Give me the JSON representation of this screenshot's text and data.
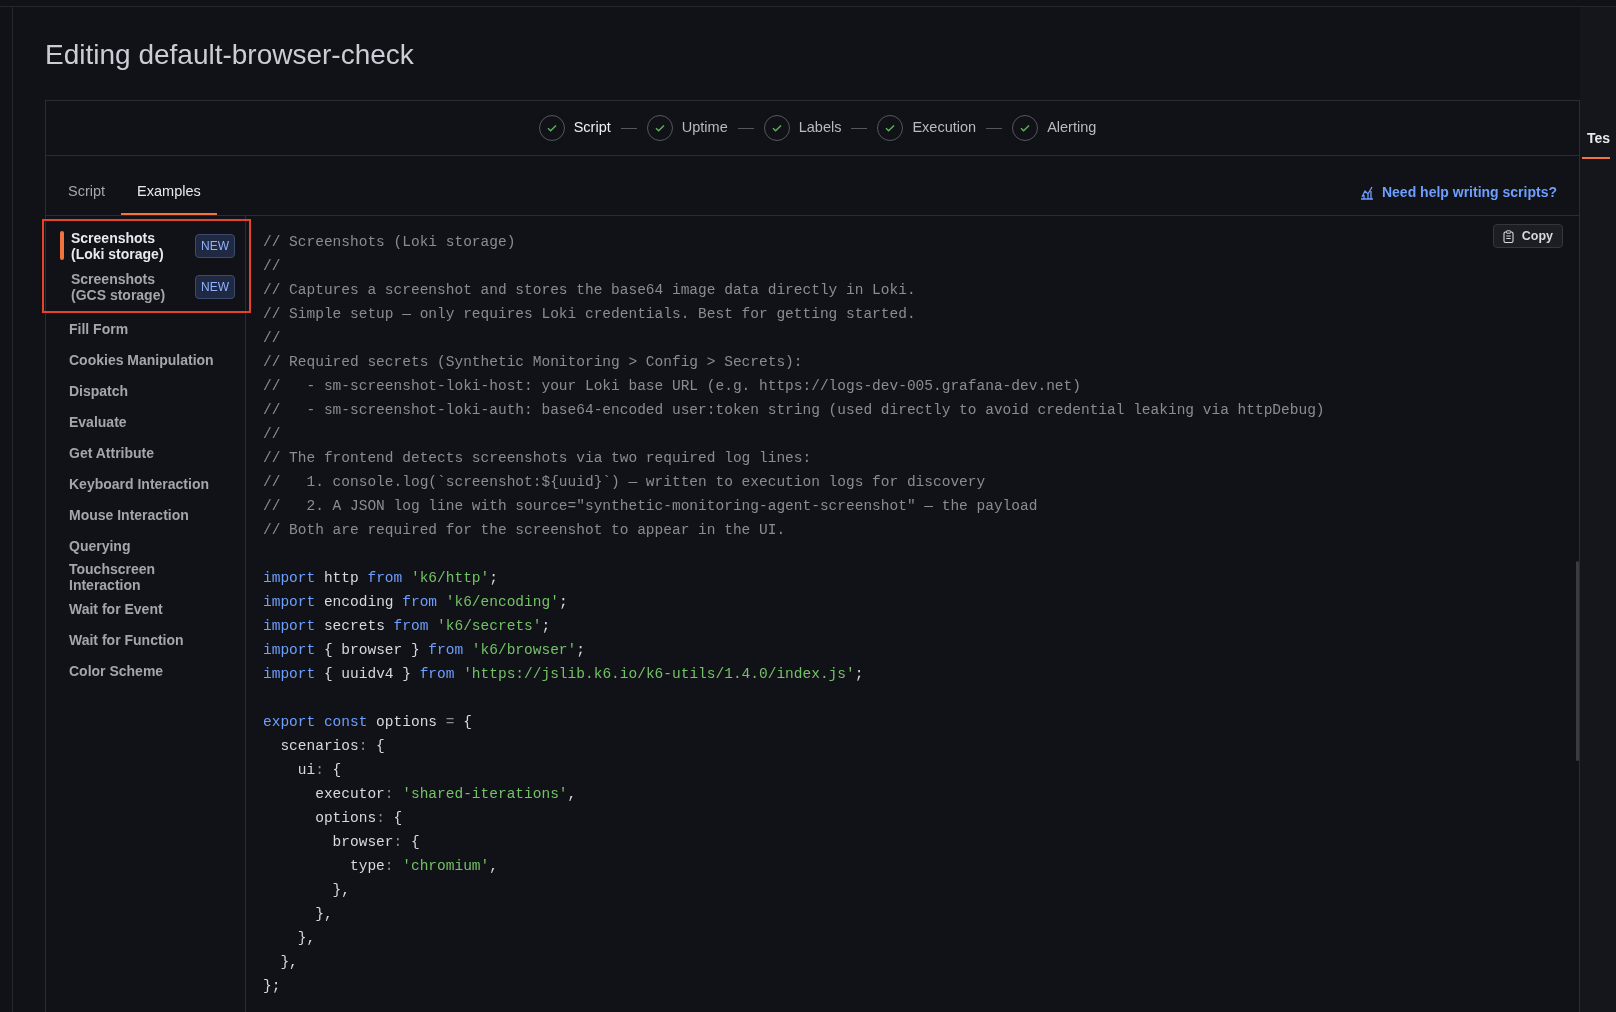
{
  "page": {
    "title": "Editing default-browser-check"
  },
  "stepper": [
    {
      "label": "Script",
      "done": true,
      "selected": true
    },
    {
      "label": "Uptime",
      "done": true,
      "selected": false
    },
    {
      "label": "Labels",
      "done": true,
      "selected": false
    },
    {
      "label": "Execution",
      "done": true,
      "selected": false
    },
    {
      "label": "Alerting",
      "done": true,
      "selected": false
    }
  ],
  "tabs": [
    {
      "label": "Script",
      "selected": false
    },
    {
      "label": "Examples",
      "selected": true
    }
  ],
  "help_link": "Need help writing scripts?",
  "sidebar": {
    "highlighted_items": [
      {
        "label": "Screenshots (Loki storage)",
        "badge": "NEW",
        "selected": true
      },
      {
        "label": "Screenshots (GCS storage)",
        "badge": "NEW",
        "selected": false
      }
    ],
    "items": [
      {
        "label": "Fill Form",
        "selected": false
      },
      {
        "label": "Cookies Manipulation",
        "selected": false
      },
      {
        "label": "Dispatch",
        "selected": false
      },
      {
        "label": "Evaluate",
        "selected": false
      },
      {
        "label": "Get Attribute",
        "selected": false
      },
      {
        "label": "Keyboard Interaction",
        "selected": false
      },
      {
        "label": "Mouse Interaction",
        "selected": false
      },
      {
        "label": "Querying",
        "selected": false
      },
      {
        "label": "Touchscreen Interaction",
        "selected": false
      },
      {
        "label": "Wait for Event",
        "selected": false
      },
      {
        "label": "Wait for Function",
        "selected": false
      },
      {
        "label": "Color Scheme",
        "selected": false
      }
    ]
  },
  "copy_button": "Copy",
  "code": [
    {
      "kind": "code",
      "tokens": [
        {
          "kind": "comment",
          "text": "// Screenshots (Loki storage)"
        }
      ]
    },
    {
      "kind": "code",
      "tokens": [
        {
          "kind": "comment",
          "text": "//"
        }
      ]
    },
    {
      "kind": "code",
      "tokens": [
        {
          "kind": "comment",
          "text": "// Captures a screenshot and stores the base64 image data directly in Loki."
        }
      ]
    },
    {
      "kind": "code",
      "tokens": [
        {
          "kind": "comment",
          "text": "// Simple setup — only requires Loki credentials. Best for getting started."
        }
      ]
    },
    {
      "kind": "code",
      "tokens": [
        {
          "kind": "comment",
          "text": "//"
        }
      ]
    },
    {
      "kind": "code",
      "tokens": [
        {
          "kind": "comment",
          "text": "// Required secrets (Synthetic Monitoring > Config > Secrets):"
        }
      ]
    },
    {
      "kind": "code",
      "tokens": [
        {
          "kind": "comment",
          "text": "//   - sm-screenshot-loki-host: your Loki base URL (e.g. https://logs-dev-005.grafana-dev.net)"
        }
      ]
    },
    {
      "kind": "code",
      "tokens": [
        {
          "kind": "comment",
          "text": "//   - sm-screenshot-loki-auth: base64-encoded user:token string (used directly to avoid credential leaking via httpDebug)"
        }
      ]
    },
    {
      "kind": "code",
      "tokens": [
        {
          "kind": "comment",
          "text": "//"
        }
      ]
    },
    {
      "kind": "code",
      "tokens": [
        {
          "kind": "comment",
          "text": "// The frontend detects screenshots via two required log lines:"
        }
      ]
    },
    {
      "kind": "code",
      "tokens": [
        {
          "kind": "comment",
          "text": "//   1. console.log(`screenshot:${uuid}`) — written to execution logs for discovery"
        }
      ]
    },
    {
      "kind": "code",
      "tokens": [
        {
          "kind": "comment",
          "text": "//   2. A JSON log line with source=\"synthetic-monitoring-agent-screenshot\" — the payload"
        }
      ]
    },
    {
      "kind": "code",
      "tokens": [
        {
          "kind": "comment",
          "text": "// Both are required for the screenshot to appear in the UI."
        }
      ]
    },
    {
      "kind": "blank"
    },
    {
      "kind": "code",
      "tokens": [
        {
          "kind": "keyword",
          "text": "import"
        },
        {
          "kind": "plain",
          "text": " http "
        },
        {
          "kind": "keyword",
          "text": "from "
        },
        {
          "kind": "string",
          "text": "'k6/http'"
        },
        {
          "kind": "plain",
          "text": ";"
        }
      ]
    },
    {
      "kind": "code",
      "tokens": [
        {
          "kind": "keyword",
          "text": "import"
        },
        {
          "kind": "plain",
          "text": " encoding "
        },
        {
          "kind": "keyword",
          "text": "from "
        },
        {
          "kind": "string",
          "text": "'k6/encoding'"
        },
        {
          "kind": "plain",
          "text": ";"
        }
      ]
    },
    {
      "kind": "code",
      "tokens": [
        {
          "kind": "keyword",
          "text": "import"
        },
        {
          "kind": "plain",
          "text": " secrets "
        },
        {
          "kind": "keyword",
          "text": "from "
        },
        {
          "kind": "string",
          "text": "'k6/secrets'"
        },
        {
          "kind": "plain",
          "text": ";"
        }
      ]
    },
    {
      "kind": "code",
      "tokens": [
        {
          "kind": "keyword",
          "text": "import"
        },
        {
          "kind": "plain",
          "text": " { browser } "
        },
        {
          "kind": "keyword",
          "text": "from "
        },
        {
          "kind": "string",
          "text": "'k6/browser'"
        },
        {
          "kind": "plain",
          "text": ";"
        }
      ]
    },
    {
      "kind": "code",
      "tokens": [
        {
          "kind": "keyword",
          "text": "import"
        },
        {
          "kind": "plain",
          "text": " { uuidv4 } "
        },
        {
          "kind": "keyword",
          "text": "from "
        },
        {
          "kind": "string",
          "text": "'https://jslib.k6.io/k6-utils/1.4.0/index.js'"
        },
        {
          "kind": "plain",
          "text": ";"
        }
      ]
    },
    {
      "kind": "blank"
    },
    {
      "kind": "code",
      "tokens": [
        {
          "kind": "keyword",
          "text": "export const"
        },
        {
          "kind": "plain",
          "text": " options "
        },
        {
          "kind": "punct",
          "text": "="
        },
        {
          "kind": "plain",
          "text": " {"
        }
      ]
    },
    {
      "kind": "code",
      "tokens": [
        {
          "kind": "plain",
          "text": "  scenarios"
        },
        {
          "kind": "punct",
          "text": ":"
        },
        {
          "kind": "plain",
          "text": " {"
        }
      ]
    },
    {
      "kind": "code",
      "tokens": [
        {
          "kind": "plain",
          "text": "    ui"
        },
        {
          "kind": "punct",
          "text": ":"
        },
        {
          "kind": "plain",
          "text": " {"
        }
      ]
    },
    {
      "kind": "code",
      "tokens": [
        {
          "kind": "plain",
          "text": "      executor"
        },
        {
          "kind": "punct",
          "text": ": "
        },
        {
          "kind": "string",
          "text": "'shared-iterations'"
        },
        {
          "kind": "plain",
          "text": ","
        }
      ]
    },
    {
      "kind": "code",
      "tokens": [
        {
          "kind": "plain",
          "text": "      options"
        },
        {
          "kind": "punct",
          "text": ":"
        },
        {
          "kind": "plain",
          "text": " {"
        }
      ]
    },
    {
      "kind": "code",
      "tokens": [
        {
          "kind": "plain",
          "text": "        browser"
        },
        {
          "kind": "punct",
          "text": ":"
        },
        {
          "kind": "plain",
          "text": " {"
        }
      ]
    },
    {
      "kind": "code",
      "tokens": [
        {
          "kind": "plain",
          "text": "          type"
        },
        {
          "kind": "punct",
          "text": ": "
        },
        {
          "kind": "string",
          "text": "'chromium'"
        },
        {
          "kind": "plain",
          "text": ","
        }
      ]
    },
    {
      "kind": "code",
      "tokens": [
        {
          "kind": "plain",
          "text": "        },"
        }
      ]
    },
    {
      "kind": "code",
      "tokens": [
        {
          "kind": "plain",
          "text": "      },"
        }
      ]
    },
    {
      "kind": "code",
      "tokens": [
        {
          "kind": "plain",
          "text": "    },"
        }
      ]
    },
    {
      "kind": "code",
      "tokens": [
        {
          "kind": "plain",
          "text": "  },"
        }
      ]
    },
    {
      "kind": "code",
      "tokens": [
        {
          "kind": "plain",
          "text": "};"
        }
      ]
    }
  ],
  "side_panel": {
    "tabs": [
      {
        "label": "Tes",
        "selected": true
      }
    ]
  }
}
